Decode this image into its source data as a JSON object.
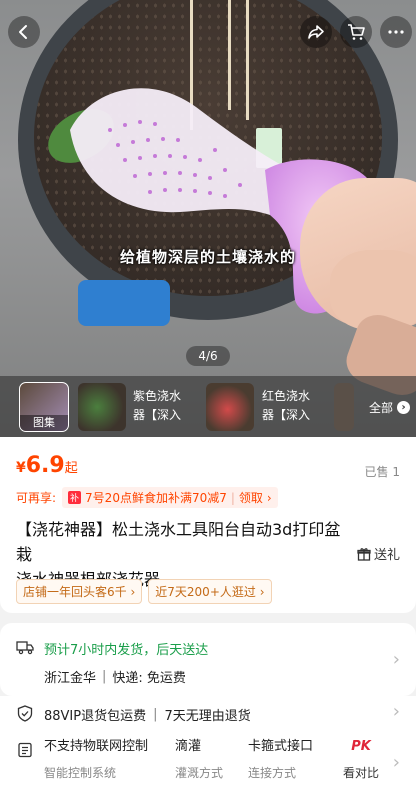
{
  "gallery": {
    "caption": "给植物深层的土壤浇水的",
    "counter": "4/6",
    "thumbnails": [
      {
        "label": "图集"
      },
      {
        "label": "紫色浇水\n器【深入"
      },
      {
        "label": "红色浇水\n器【深入"
      }
    ],
    "all_label": "全部"
  },
  "product": {
    "price_currency": "¥",
    "price_value": "6.9",
    "price_suffix": "起",
    "sold": "已售 1",
    "promo_label": "可再享:",
    "promo_text": "7号20点鲜食加补满70减7",
    "promo_action": "领取",
    "title_line1": "【浇花神器】松土浇水工具阳台自动3d打印盆栽",
    "title_line2": "浇水神器根部浇花器",
    "gift": "送礼",
    "tags": [
      "店铺一年回头客6千",
      "近7天200+人逛过"
    ]
  },
  "shipping": {
    "delivery": "预计7小时内发货，后天送达",
    "origin": "浙江金华",
    "fee": "快递: 免运费"
  },
  "service": {
    "items": [
      "88VIP退货包运费",
      "7天无理由退货"
    ]
  },
  "specs": {
    "columns": [
      {
        "main": "不支持物联网控制",
        "sub": "智能控制系统"
      },
      {
        "main": "滴灌",
        "sub": "灌溉方式"
      },
      {
        "main": "卡箍式接口",
        "sub": "连接方式"
      },
      {
        "main": "PK",
        "sub": "看对比"
      }
    ]
  },
  "colors": {
    "accent": "#ff4400",
    "green": "#1a9e4a"
  }
}
